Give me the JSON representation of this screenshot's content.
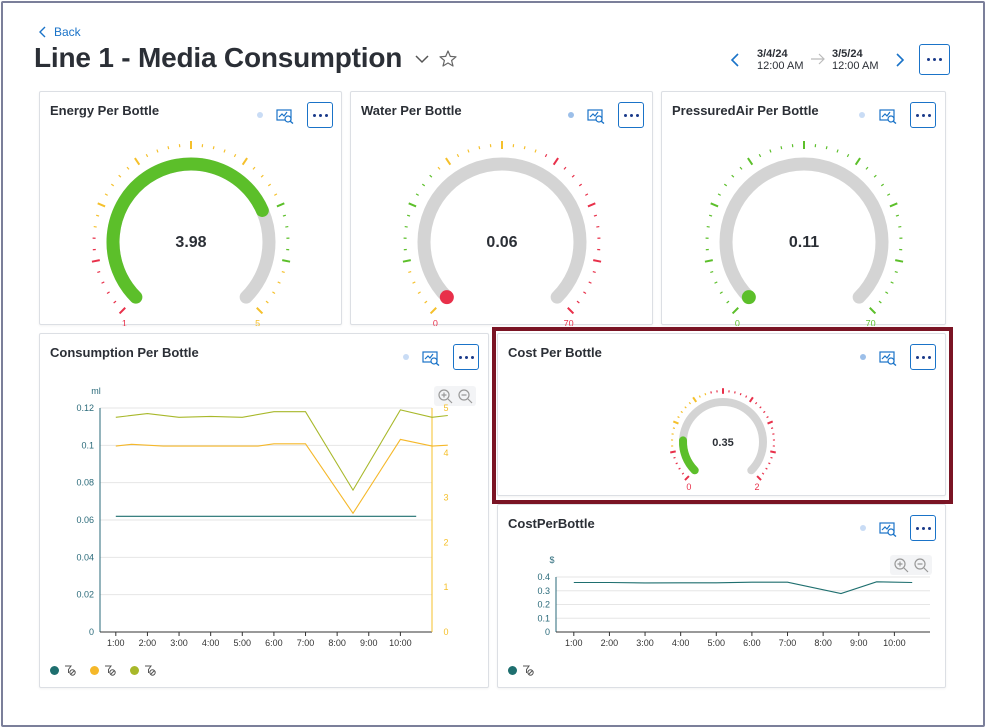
{
  "header": {
    "back_label": "Back",
    "title": "Line 1 - Media Consumption",
    "date_from": {
      "date": "3/4/24",
      "time": "12:00 AM"
    },
    "date_to": {
      "date": "3/5/24",
      "time": "12:00 AM"
    }
  },
  "colors": {
    "accent": "#1a73c8",
    "good": "#5cbf2a",
    "warn": "#f5c02b",
    "bad": "#e8304a",
    "track": "#d4d4d4",
    "highlight": "#7a1424"
  },
  "gauges": [
    {
      "title": "Energy Per Bottle",
      "value": "3.98",
      "numeric": 3.98,
      "min": "1",
      "max": "5",
      "min_v": 1,
      "max_v": 5,
      "min_color": "#e8304a",
      "max_color": "#f5c02b",
      "fill_color": "#5cbf2a"
    },
    {
      "title": "Water Per Bottle",
      "value": "0.06",
      "numeric": 0.06,
      "min": "0",
      "max": "70",
      "min_v": 0,
      "max_v": 70,
      "min_color": "#e8304a",
      "max_color": "#e8304a",
      "fill_color": "#e8304a"
    },
    {
      "title": "PressuredAir Per Bottle",
      "value": "0.11",
      "numeric": 0.11,
      "min": "0",
      "max": "70",
      "min_v": 0,
      "max_v": 70,
      "min_color": "#5cbf2a",
      "max_color": "#5cbf2a",
      "fill_color": "#5cbf2a"
    },
    {
      "title": "Cost Per Bottle",
      "value": "0.35",
      "numeric": 0.35,
      "min": "0",
      "max": "2",
      "min_v": 0,
      "max_v": 2,
      "min_color": "#e8304a",
      "max_color": "#e8304a",
      "fill_color": "#5cbf2a"
    }
  ],
  "consumption": {
    "title": "Consumption Per Bottle",
    "y_unit": "ml",
    "chart_data": {
      "type": "line",
      "x": [
        "1:00",
        "2:00",
        "3:00",
        "4:00",
        "5:00",
        "6:00",
        "7:00",
        "8:00",
        "9:00",
        "10:00"
      ],
      "y_ticks_left": [
        "0.12",
        "0.1",
        "0.08",
        "0.06",
        "0.04",
        "0.02",
        "0"
      ],
      "y_ticks_right": [
        "5",
        "4",
        "3",
        "2",
        "1",
        "0"
      ],
      "ylim_left": [
        0,
        0.12
      ],
      "ylim_right": [
        0,
        5
      ],
      "series": [
        {
          "axis": "left",
          "color": "#1e6f6f",
          "points": [
            [
              0,
              0.062
            ],
            [
              9.5,
              0.062
            ]
          ]
        },
        {
          "axis": "right",
          "color": "#f5b82a",
          "points": [
            [
              0,
              4.15
            ],
            [
              0.5,
              4.19
            ],
            [
              1.5,
              4.15
            ],
            [
              2.5,
              4.15
            ],
            [
              3.5,
              4.15
            ],
            [
              4.5,
              4.15
            ],
            [
              5,
              4.2
            ],
            [
              6,
              4.2
            ],
            [
              7.5,
              2.65
            ],
            [
              9,
              4.3
            ],
            [
              10,
              4.15
            ],
            [
              10.5,
              4.17
            ]
          ]
        },
        {
          "axis": "left",
          "color": "#a8b82a",
          "points": [
            [
              0,
              0.115
            ],
            [
              1,
              0.117
            ],
            [
              2,
              0.115
            ],
            [
              3,
              0.1155
            ],
            [
              4,
              0.115
            ],
            [
              5,
              0.118
            ],
            [
              6,
              0.118
            ],
            [
              7.5,
              0.076
            ],
            [
              9,
              0.119
            ],
            [
              10,
              0.115
            ],
            [
              10.5,
              0.116
            ]
          ]
        }
      ]
    },
    "legend": [
      {
        "color": "#1e6f6f"
      },
      {
        "color": "#f5b82a"
      },
      {
        "color": "#a8b82a"
      }
    ]
  },
  "cost_series": {
    "title": "CostPerBottle",
    "y_unit": "$",
    "chart_data": {
      "type": "line",
      "x": [
        "1:00",
        "2:00",
        "3:00",
        "4:00",
        "5:00",
        "6:00",
        "7:00",
        "8:00",
        "9:00",
        "10:00"
      ],
      "y_ticks": [
        "0.4",
        "0.3",
        "0.2",
        "0.1",
        "0"
      ],
      "ylim": [
        0,
        0.4
      ],
      "series": [
        {
          "color": "#1e6f6f",
          "points": [
            [
              0,
              0.36
            ],
            [
              1,
              0.36
            ],
            [
              2,
              0.357
            ],
            [
              3,
              0.358
            ],
            [
              4,
              0.358
            ],
            [
              5,
              0.362
            ],
            [
              6,
              0.362
            ],
            [
              7.5,
              0.28
            ],
            [
              8.5,
              0.365
            ],
            [
              9.5,
              0.36
            ]
          ]
        }
      ]
    },
    "legend": [
      {
        "color": "#1e6f6f"
      }
    ]
  }
}
